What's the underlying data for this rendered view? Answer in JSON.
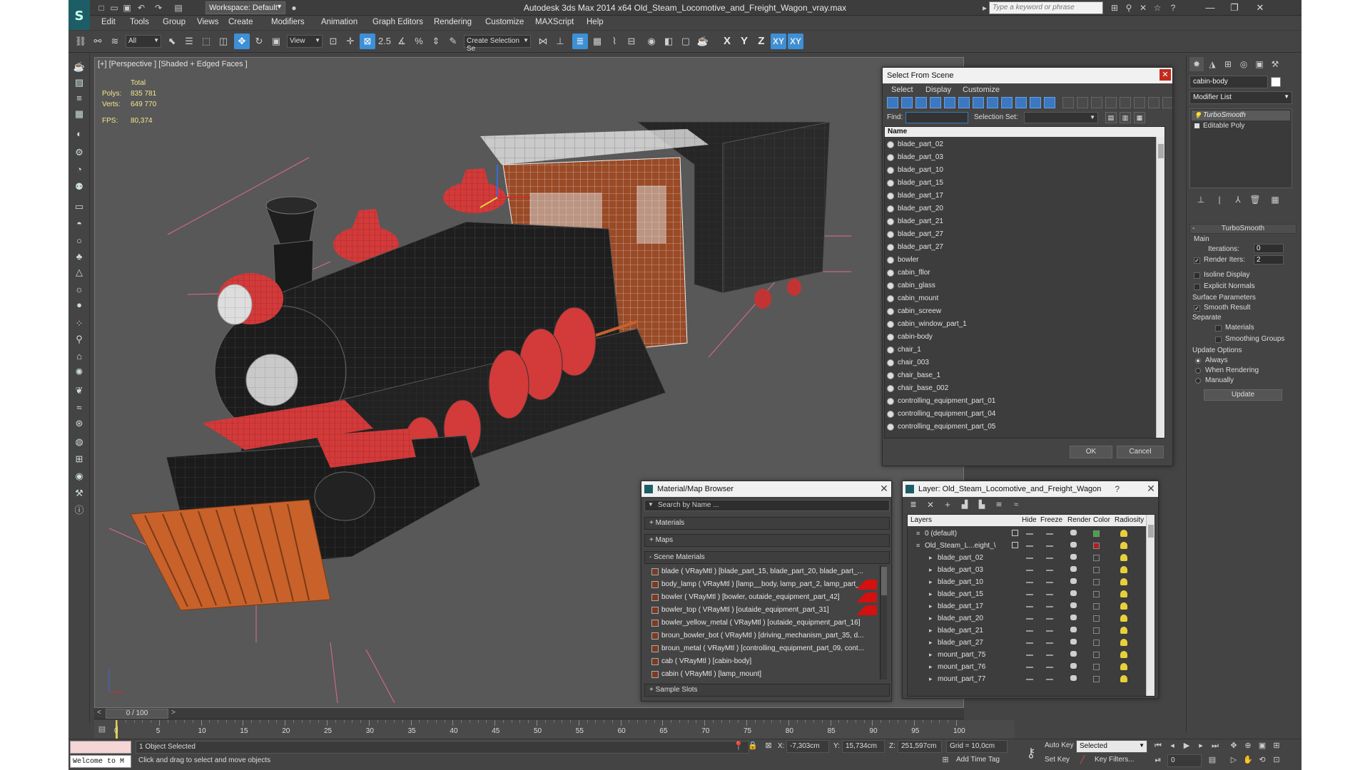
{
  "titlebar": {
    "workspace": "Workspace: Default",
    "title": "Autodesk 3ds Max  2014 x64      Old_Steam_Locomotive_and_Freight_Wagon_vray.max",
    "search_placeholder": "Type a keyword or phrase"
  },
  "menus": [
    "Edit",
    "Tools",
    "Group",
    "Views",
    "Create",
    "Modifiers",
    "Animation",
    "Graph Editors",
    "Rendering",
    "Customize",
    "MAXScript",
    "Help"
  ],
  "toolbar": {
    "selection_filter": "All",
    "ref_coord": "View",
    "selection_set_placeholder": "Create Selection Se",
    "snap_label": "2.5",
    "angle_snap_label": "%",
    "axes": [
      "X",
      "Y",
      "Z",
      "XY",
      "XY"
    ]
  },
  "viewport": {
    "label": "[+] [Perspective ] [Shaded + Edged Faces ]",
    "stats_header": "Total",
    "polys_label": "Polys:",
    "polys": "835 781",
    "verts_label": "Verts:",
    "verts": "649 770",
    "fps_label": "FPS:",
    "fps": "80,374"
  },
  "select_from_scene": {
    "title": "Select From Scene",
    "menu": [
      "Select",
      "Display",
      "Customize"
    ],
    "find_label": "Find:",
    "selection_set_label": "Selection Set:",
    "column_name": "Name",
    "items": [
      "blade_part_02",
      "blade_part_03",
      "blade_part_10",
      "blade_part_15",
      "blade_part_17",
      "blade_part_20",
      "blade_part_21",
      "blade_part_27",
      "blade_part_27",
      "bowler",
      "cabin_fllor",
      "cabin_glass",
      "cabin_mount",
      "cabin_screew",
      "cabin_window_part_1",
      "cabin-body",
      "chair_1",
      "chair_003",
      "chair_base_1",
      "chair_base_002",
      "controlling_equipment_part_01",
      "controlling_equipment_part_04",
      "controlling_equipment_part_05"
    ],
    "ok": "OK",
    "cancel": "Cancel"
  },
  "material_browser": {
    "title": "Material/Map Browser",
    "search_placeholder": "Search by Name ...",
    "sections": [
      "+ Materials",
      "+ Maps",
      "- Scene Materials"
    ],
    "items": [
      {
        "text": "blade  ( VRayMtl ) [blade_part_15, blade_part_20, blade_part_...",
        "red": false
      },
      {
        "text": "body_lamp  ( VRayMtl ) [lamp__body, lamp_part_2, lamp_part_...",
        "red": true
      },
      {
        "text": "bowler  ( VRayMtl ) [bowler, outaide_equipment_part_42]",
        "red": true
      },
      {
        "text": "bowler_top  ( VRayMtl ) [outaide_equipment_part_31]",
        "red": true
      },
      {
        "text": "bowler_yellow_metal  ( VRayMtl ) [outaide_equipment_part_16]",
        "red": false
      },
      {
        "text": "broun_bowler_bot  ( VRayMtl ) [driving_mechanism_part_35, d...",
        "red": false
      },
      {
        "text": "broun_metal  ( VRayMtl ) [controlling_equipment_part_09, cont...",
        "red": false
      },
      {
        "text": "cab  ( VRayMtl ) [cabin-body]",
        "red": false
      },
      {
        "text": "cabin  ( VRayMtl ) [lamp_mount]",
        "red": false
      }
    ],
    "sample_slots": "+ Sample Slots"
  },
  "layer_dialog": {
    "title": "Layer: Old_Steam_Locomotive_and_Freight_Wagon",
    "help": "?",
    "columns": [
      "Layers",
      "Hide",
      "Freeze",
      "Render",
      "Color",
      "Radiosity"
    ],
    "rows": [
      {
        "name": "0 (default)",
        "indent": 0,
        "color": "#3fa83f"
      },
      {
        "name": "Old_Steam_L...eight_\\",
        "indent": 0,
        "color": "#b01e1e"
      },
      {
        "name": "blade_part_02",
        "indent": 1,
        "color": ""
      },
      {
        "name": "blade_part_03",
        "indent": 1,
        "color": ""
      },
      {
        "name": "blade_part_10",
        "indent": 1,
        "color": ""
      },
      {
        "name": "blade_part_15",
        "indent": 1,
        "color": ""
      },
      {
        "name": "blade_part_17",
        "indent": 1,
        "color": ""
      },
      {
        "name": "blade_part_20",
        "indent": 1,
        "color": ""
      },
      {
        "name": "blade_part_21",
        "indent": 1,
        "color": ""
      },
      {
        "name": "blade_part_27",
        "indent": 1,
        "color": ""
      },
      {
        "name": "mount_part_75",
        "indent": 1,
        "color": ""
      },
      {
        "name": "mount_part_76",
        "indent": 1,
        "color": ""
      },
      {
        "name": "mount_part_77",
        "indent": 1,
        "color": ""
      }
    ]
  },
  "command_panel": {
    "object_name": "cabin-body",
    "modifier_list": "Modifier List",
    "stack": [
      "TurboSmooth",
      "Editable Poly"
    ],
    "rollout": "TurboSmooth",
    "main_label": "Main",
    "iterations_label": "Iterations:",
    "iterations": "0",
    "render_iters_label": "Render Iters:",
    "render_iters": "2",
    "isoline": "Isoline Display",
    "explicit_normals": "Explicit Normals",
    "surface_params": "Surface Parameters",
    "smooth_result": "Smooth Result",
    "separate": "Separate",
    "materials": "Materials",
    "smoothing_groups": "Smoothing Groups",
    "update_options": "Update Options",
    "always": "Always",
    "when_rendering": "When Rendering",
    "manually": "Manually",
    "update": "Update"
  },
  "timeline": {
    "frame": "0 / 100",
    "ticks": [
      "0",
      "5",
      "10",
      "15",
      "20",
      "25",
      "30",
      "35",
      "40",
      "45",
      "50",
      "55",
      "60",
      "65",
      "70",
      "75",
      "80",
      "85",
      "90",
      "95",
      "100"
    ]
  },
  "status": {
    "maxscript": "Welcome to M",
    "selected": "1 Object Selected",
    "prompt": "Click and drag to select and move objects",
    "x_label": "X:",
    "x": "-7,303cm",
    "y_label": "Y:",
    "y": "15,734cm",
    "z_label": "Z:",
    "z": "251,597cm",
    "grid": "Grid = 10,0cm",
    "add_time_tag": "Add Time Tag",
    "auto_key": "Auto Key",
    "set_key": "Set Key",
    "key_mode": "Selected",
    "key_filters": "Key Filters...",
    "frame_field": "0"
  },
  "colors": {
    "accent": "#3d8fd6",
    "viewport_bg": "#585858",
    "model_red": "#d33a3a",
    "model_black": "#1e1e1e",
    "model_orange": "#c8612a"
  }
}
